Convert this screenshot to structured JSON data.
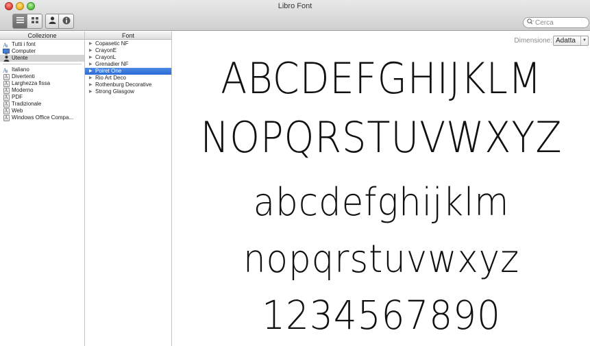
{
  "window": {
    "title": "Libro Font"
  },
  "toolbar": {
    "buttons": [
      {
        "name": "list-view-icon"
      },
      {
        "name": "grid-view-icon"
      },
      {
        "name": "user-icon"
      },
      {
        "name": "info-icon"
      }
    ],
    "search": {
      "placeholder": "Cerca"
    }
  },
  "collections": {
    "header": "Collezione",
    "top": [
      {
        "label": "Tutti i font",
        "icon": "all-fonts-icon"
      },
      {
        "label": "Computer",
        "icon": "computer-icon"
      },
      {
        "label": "Utente",
        "icon": "user-icon",
        "selected": true
      }
    ],
    "groups": [
      {
        "label": "Italiano",
        "icon": "all-fonts-icon"
      },
      {
        "label": "Divertenti",
        "icon": "font-collection-icon"
      },
      {
        "label": "Larghezza fissa",
        "icon": "font-collection-icon"
      },
      {
        "label": "Moderno",
        "icon": "font-collection-icon"
      },
      {
        "label": "PDF",
        "icon": "font-collection-icon"
      },
      {
        "label": "Tradizionale",
        "icon": "font-collection-icon"
      },
      {
        "label": "Web",
        "icon": "font-collection-icon"
      },
      {
        "label": "Windows Office Compa...",
        "icon": "font-collection-icon"
      }
    ]
  },
  "fonts": {
    "header": "Font",
    "items": [
      {
        "label": "Copasetic NF"
      },
      {
        "label": "CrayonE"
      },
      {
        "label": "CrayonL"
      },
      {
        "label": "Grenadier NF"
      },
      {
        "label": "Poiret One",
        "selected": true
      },
      {
        "label": "Rio Art Deco"
      },
      {
        "label": "Rothenburg Decorative"
      },
      {
        "label": "Strong Glasgow"
      }
    ]
  },
  "preview": {
    "size_label": "Dimensione:",
    "size_value": "Adatta",
    "lines": [
      "ABCDEFGHIJKLM",
      "NOPQRSTUVWXYZ",
      "abcdefghijklm",
      "nopqrstuvwxyz",
      "1234567890"
    ]
  },
  "colors": {
    "selection_blue": "#3a78dc",
    "selection_gray": "#d4d4d4"
  }
}
